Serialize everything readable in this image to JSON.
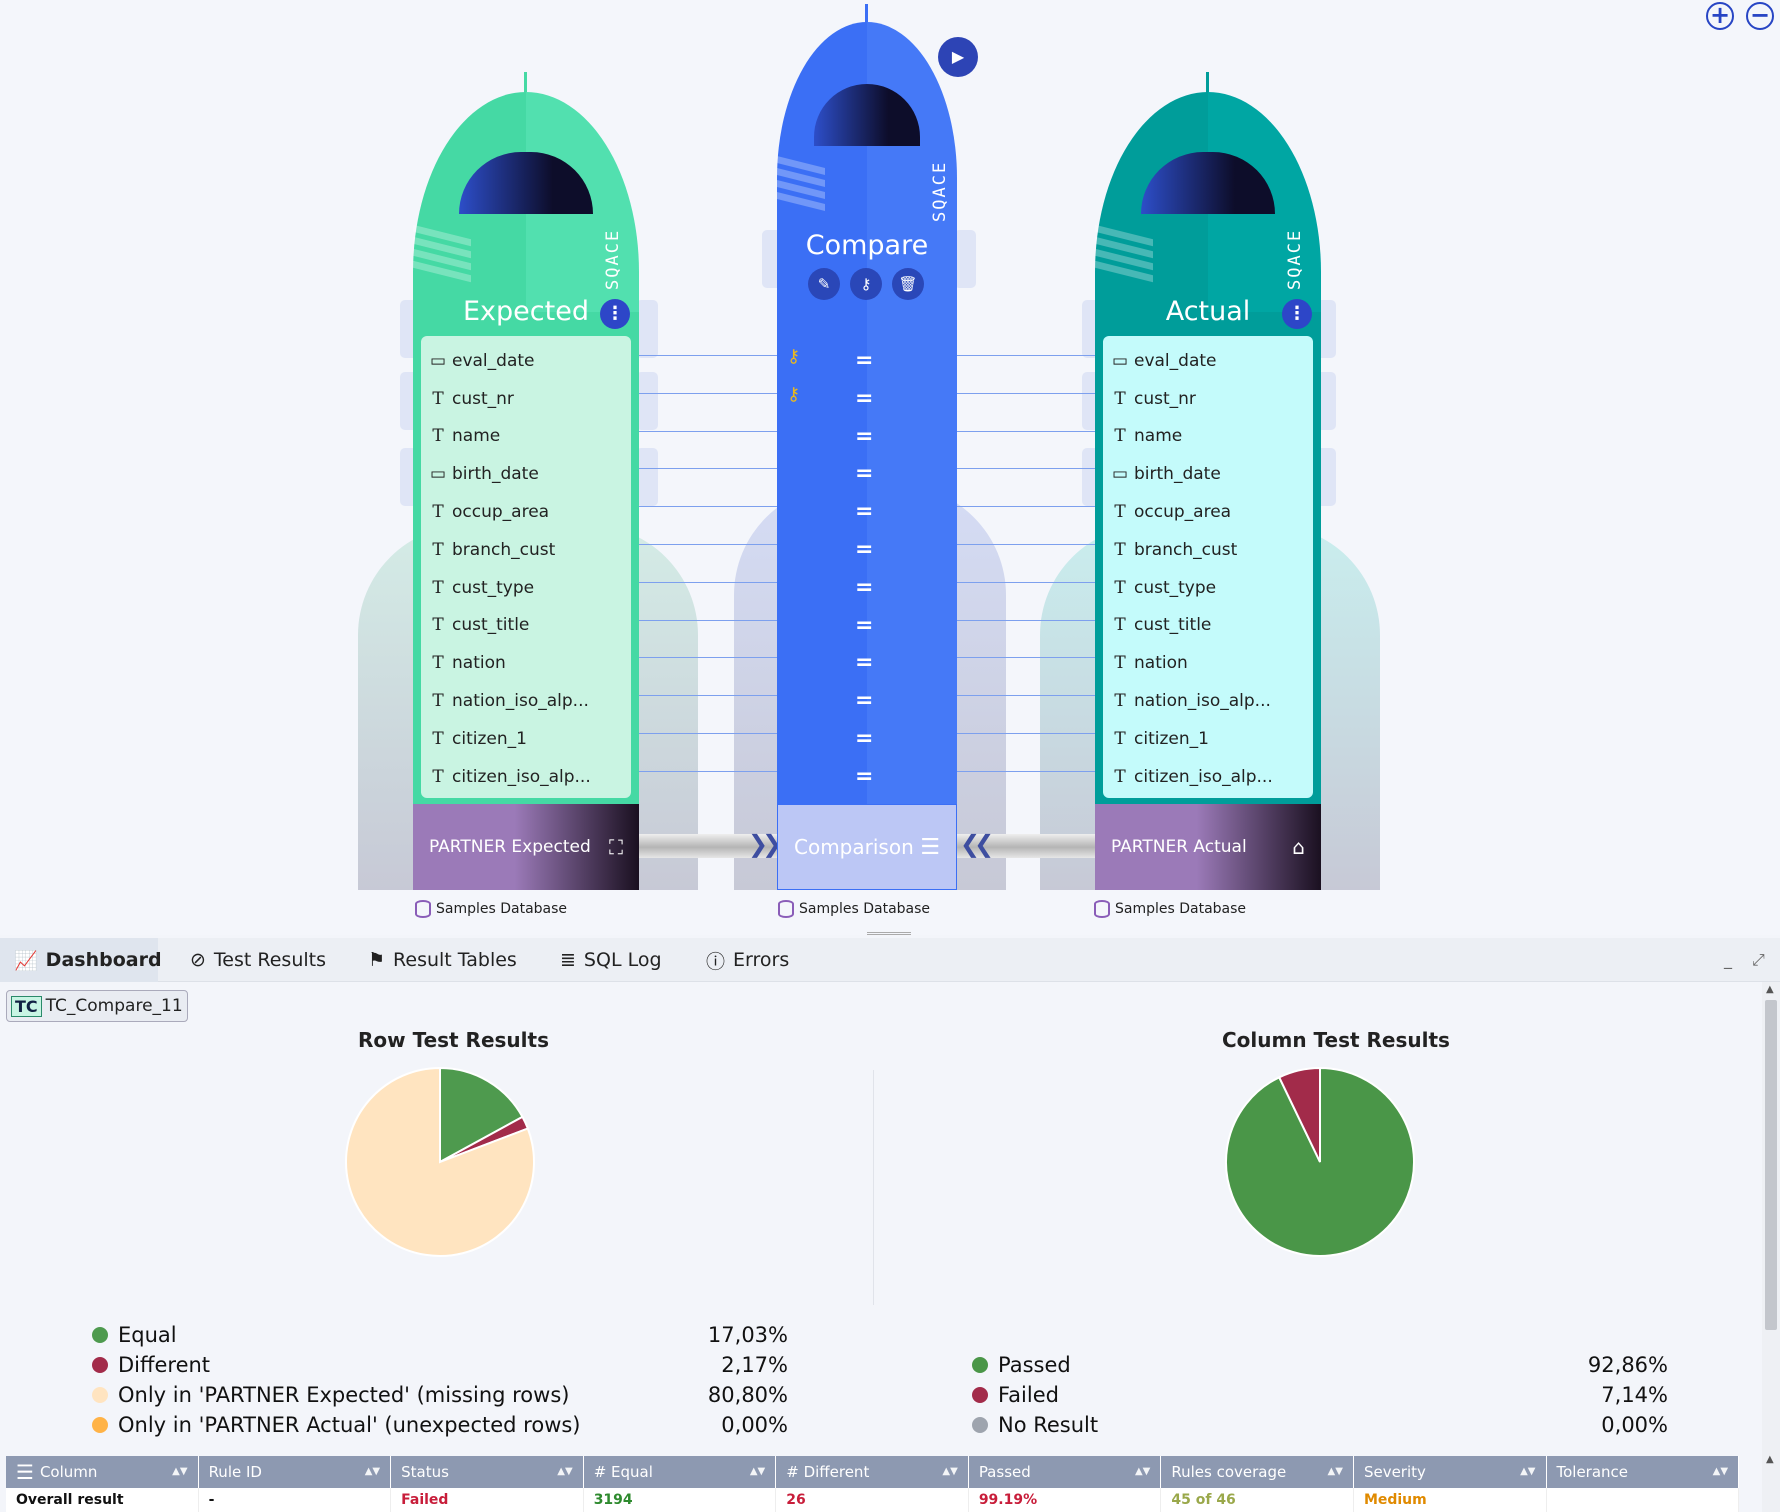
{
  "zoom": {
    "in_symbol": "+",
    "out_symbol": "−"
  },
  "expected": {
    "title": "Expected",
    "brand": "SQACE",
    "base_label": "PARTNER Expected",
    "db_label": "Samples Database",
    "color": "#45d9a4"
  },
  "compare": {
    "title": "Compare",
    "brand": "SQACE",
    "base_label": "Comparison",
    "db_label": "Samples Database",
    "color": "#3b6ff5",
    "equal_symbol": "="
  },
  "actual": {
    "title": "Actual",
    "brand": "SQACE",
    "base_label": "PARTNER Actual",
    "db_label": "Samples Database",
    "color": "#009d9a"
  },
  "fields": [
    {
      "icon": "calendar-icon",
      "glyph": "▭",
      "name": "eval_date",
      "key": true
    },
    {
      "icon": "text-type-icon",
      "glyph": "T",
      "name": "cust_nr",
      "key": true
    },
    {
      "icon": "text-type-icon",
      "glyph": "T",
      "name": "name",
      "key": false
    },
    {
      "icon": "calendar-icon",
      "glyph": "▭",
      "name": "birth_date",
      "key": false
    },
    {
      "icon": "text-type-icon",
      "glyph": "T",
      "name": "occup_area",
      "key": false
    },
    {
      "icon": "text-type-icon",
      "glyph": "T",
      "name": "branch_cust",
      "key": false
    },
    {
      "icon": "text-type-icon",
      "glyph": "T",
      "name": "cust_type",
      "key": false
    },
    {
      "icon": "text-type-icon",
      "glyph": "T",
      "name": "cust_title",
      "key": false
    },
    {
      "icon": "text-type-icon",
      "glyph": "T",
      "name": "nation",
      "key": false
    },
    {
      "icon": "text-type-icon",
      "glyph": "T",
      "name": "nation_iso_alp...",
      "key": false
    },
    {
      "icon": "text-type-icon",
      "glyph": "T",
      "name": "citizen_1",
      "key": false
    },
    {
      "icon": "text-type-icon",
      "glyph": "T",
      "name": "citizen_iso_alp...",
      "key": false
    }
  ],
  "tabs": [
    {
      "label": "Dashboard",
      "icon": "chart-line-icon",
      "glyph": "⟋",
      "active": true
    },
    {
      "label": "Test Results",
      "icon": "check-circle-icon",
      "glyph": "✓",
      "active": false
    },
    {
      "label": "Result Tables",
      "icon": "flag-icon",
      "glyph": "⚑",
      "active": false
    },
    {
      "label": "SQL Log",
      "icon": "log-icon",
      "glyph": "≣",
      "active": false
    },
    {
      "label": "Errors",
      "icon": "error-icon",
      "glyph": "!",
      "active": false
    }
  ],
  "testcase": {
    "badge": "TC",
    "name": "TC_Compare_11"
  },
  "row_chart": {
    "title": "Row Test Results",
    "legend": [
      {
        "label": "Equal",
        "value": "17,03%",
        "pct": 17.03,
        "color": "#4e9a4e"
      },
      {
        "label": "Different",
        "value": "2,17%",
        "pct": 2.17,
        "color": "#a22b4a"
      },
      {
        "label": "Only in 'PARTNER Expected' (missing rows)",
        "value": "80,80%",
        "pct": 80.8,
        "color": "#ffe4c0"
      },
      {
        "label": "Only in 'PARTNER Actual' (unexpected rows)",
        "value": "0,00%",
        "pct": 0.0,
        "color": "#ffb347"
      }
    ]
  },
  "column_chart": {
    "title": "Column Test Results",
    "legend": [
      {
        "label": "Passed",
        "value": "92,86%",
        "pct": 92.86,
        "color": "#4a9648"
      },
      {
        "label": "Failed",
        "value": "7,14%",
        "pct": 7.14,
        "color": "#a22b4a"
      },
      {
        "label": "No Result",
        "value": "0,00%",
        "pct": 0.0,
        "color": "#9ea4ae"
      }
    ]
  },
  "chart_data": [
    {
      "type": "pie",
      "title": "Row Test Results",
      "categories": [
        "Equal",
        "Different",
        "Only in 'PARTNER Expected' (missing rows)",
        "Only in 'PARTNER Actual' (unexpected rows)"
      ],
      "values": [
        17.03,
        2.17,
        80.8,
        0.0
      ],
      "legend": "bottom"
    },
    {
      "type": "pie",
      "title": "Column Test Results",
      "categories": [
        "Passed",
        "Failed",
        "No Result"
      ],
      "values": [
        92.86,
        7.14,
        0.0
      ],
      "legend": "bottom"
    }
  ],
  "grid": {
    "columns": [
      "Column",
      "Rule ID",
      "Status",
      "# Equal",
      "# Different",
      "Passed",
      "Rules coverage",
      "Severity",
      "Tolerance"
    ],
    "rows": [
      {
        "cells": [
          "Overall result",
          "-",
          "Failed",
          "3194",
          "26",
          "99.19%",
          "45 of 46",
          "Medium",
          ""
        ],
        "colors": [
          "#111",
          "#111",
          "#c81d3a",
          "#2e8a2e",
          "#c81d3a",
          "#c81d3a",
          "#9aa84a",
          "#e08a00",
          "#111"
        ]
      }
    ]
  }
}
